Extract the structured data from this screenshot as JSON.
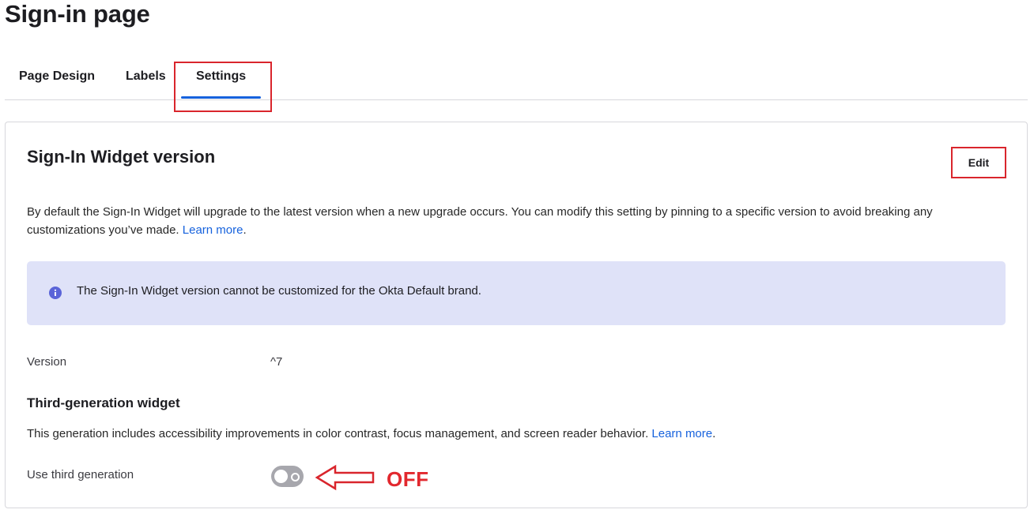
{
  "page": {
    "title": "Sign-in page"
  },
  "tabs": [
    {
      "label": "Page Design",
      "active": false
    },
    {
      "label": "Labels",
      "active": false
    },
    {
      "label": "Settings",
      "active": true
    }
  ],
  "widget_version": {
    "title": "Sign-In Widget version",
    "edit_label": "Edit",
    "description": "By default the Sign-In Widget will upgrade to the latest version when a new upgrade occurs. You can modify this setting by pinning to a specific version to avoid breaking any customizations you’ve made.",
    "learn_more": "Learn more",
    "learn_more_suffix": ".",
    "callout_text": "The Sign-In Widget version cannot be customized for the Okta Default brand.",
    "version_label": "Version",
    "version_value": "^7"
  },
  "third_gen": {
    "heading": "Third-generation widget",
    "description": "This generation includes accessibility improvements in color contrast, focus management, and screen reader behavior.",
    "learn_more": "Learn more",
    "learn_more_suffix": ".",
    "toggle_label": "Use third generation",
    "toggle_on": false
  },
  "annotations": {
    "toggle_state": "OFF"
  },
  "colors": {
    "link": "#1662dd",
    "tab_underline": "#1662dd",
    "highlight": "#d9252c",
    "callout_bg": "#dfe2f8",
    "info_icon": "#5a64d8",
    "toggle_off": "#a7a7ad"
  }
}
